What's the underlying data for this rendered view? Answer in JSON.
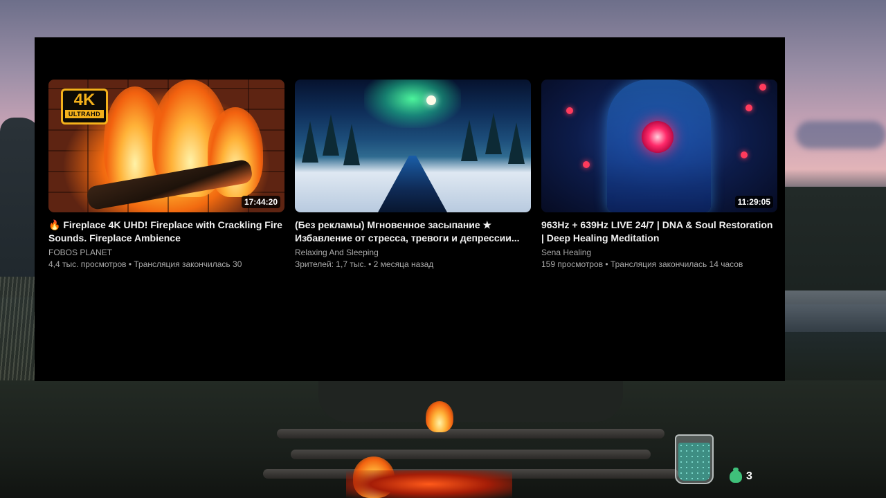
{
  "videos": [
    {
      "title": "🔥 Fireplace 4K UHD! Fireplace with Crackling Fire Sounds. Fireplace Ambience",
      "channel": "FOBOS PLANET",
      "meta": "4,4 тыс. просмотров • Трансляция закончилась 30",
      "duration": "17:44:20",
      "badge_big": "4K",
      "badge_small": "ULTRAHD"
    },
    {
      "title": "(Без рекламы) Мгновенное засыпание ★ Избавление от стресса, тревоги и депрессии...",
      "channel": "Relaxing And Sleeping",
      "meta": "Зрителей: 1,7 тыс. • 2 месяца назад",
      "duration": ""
    },
    {
      "title": "963Hz + 639Hz LIVE 24/7 | DNA & Soul Restoration | Deep Healing Meditation",
      "channel": "Sena Healing",
      "meta": "159 просмотров • Трансляция закончилась 14 часов",
      "duration": "11:29:05"
    }
  ],
  "overlay": {
    "counter_value": "3",
    "counter_icon": "puzzle-piece-icon",
    "jar_icon": "gem-jar-icon"
  }
}
